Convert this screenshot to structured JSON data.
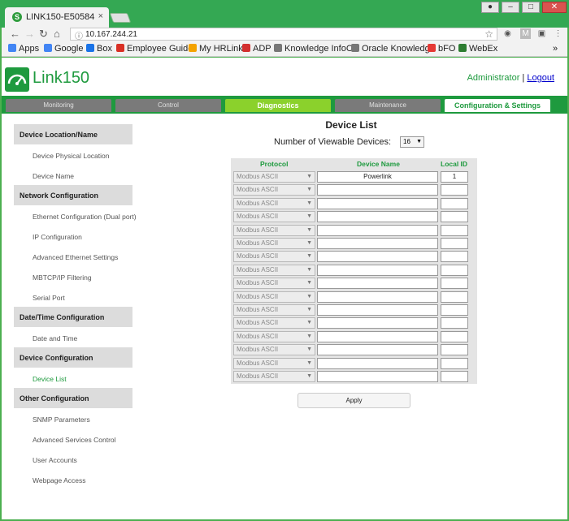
{
  "browser": {
    "tab_title": "LINK150-E50584",
    "tab_close": "×",
    "url": "10.167.244.21",
    "bookmarks": [
      "Apps",
      "Google",
      "Box",
      "Employee Guide",
      "My HRLink",
      "ADP",
      "Knowledge InfoC",
      "Oracle Knowledg",
      "bFO",
      "WebEx"
    ],
    "bookmarks_more": "»",
    "bookmark_colors": [
      "#4285f4",
      "#4285f4",
      "#1a73e8",
      "#d93025",
      "#f4a300",
      "#d32f2f",
      "#777777",
      "#777777",
      "#e53935",
      "#2e7d32"
    ]
  },
  "header": {
    "brand": "Link150",
    "user": "Administrator",
    "separator": "|",
    "logout": "Logout"
  },
  "tabs": [
    "Monitoring",
    "Control",
    "Diagnostics",
    "Maintenance",
    "Configuration & Settings"
  ],
  "sidebar": {
    "sections": [
      {
        "title": "Device Location/Name",
        "items": [
          "Device Physical Location",
          "Device Name"
        ]
      },
      {
        "title": "Network Configuration",
        "items": [
          "Ethernet Configuration (Dual port)",
          "IP Configuration",
          "Advanced Ethernet Settings",
          "MBTCP/IP Filtering",
          "Serial Port"
        ]
      },
      {
        "title": "Date/Time Configuration",
        "items": [
          "Date and Time"
        ]
      },
      {
        "title": "Device Configuration",
        "items": [
          "Device List"
        ]
      },
      {
        "title": "Other Configuration",
        "items": [
          "SNMP Parameters",
          "Advanced Services Control",
          "User Accounts",
          "Webpage Access"
        ]
      }
    ],
    "active_item": "Device List"
  },
  "main": {
    "title": "Device List",
    "viewable_label": "Number of Viewable Devices:",
    "viewable_value": "16",
    "headers": {
      "protocol": "Protocol",
      "device_name": "Device Name",
      "local_id": "Local ID"
    },
    "rows": [
      {
        "protocol": "Modbus ASCII",
        "device_name": "Powerlink",
        "local_id": "1"
      },
      {
        "protocol": "Modbus ASCII",
        "device_name": "",
        "local_id": ""
      },
      {
        "protocol": "Modbus ASCII",
        "device_name": "",
        "local_id": ""
      },
      {
        "protocol": "Modbus ASCII",
        "device_name": "",
        "local_id": ""
      },
      {
        "protocol": "Modbus ASCII",
        "device_name": "",
        "local_id": ""
      },
      {
        "protocol": "Modbus ASCII",
        "device_name": "",
        "local_id": ""
      },
      {
        "protocol": "Modbus ASCII",
        "device_name": "",
        "local_id": ""
      },
      {
        "protocol": "Modbus ASCII",
        "device_name": "",
        "local_id": ""
      },
      {
        "protocol": "Modbus ASCII",
        "device_name": "",
        "local_id": ""
      },
      {
        "protocol": "Modbus ASCII",
        "device_name": "",
        "local_id": ""
      },
      {
        "protocol": "Modbus ASCII",
        "device_name": "",
        "local_id": ""
      },
      {
        "protocol": "Modbus ASCII",
        "device_name": "",
        "local_id": ""
      },
      {
        "protocol": "Modbus ASCII",
        "device_name": "",
        "local_id": ""
      },
      {
        "protocol": "Modbus ASCII",
        "device_name": "",
        "local_id": ""
      },
      {
        "protocol": "Modbus ASCII",
        "device_name": "",
        "local_id": ""
      },
      {
        "protocol": "Modbus ASCII",
        "device_name": "",
        "local_id": ""
      }
    ],
    "apply_label": "Apply"
  },
  "colors": {
    "brand_green": "#1e9a3e",
    "active_tab": "#8bd12c",
    "inactive_tab": "#7a7a7a"
  }
}
